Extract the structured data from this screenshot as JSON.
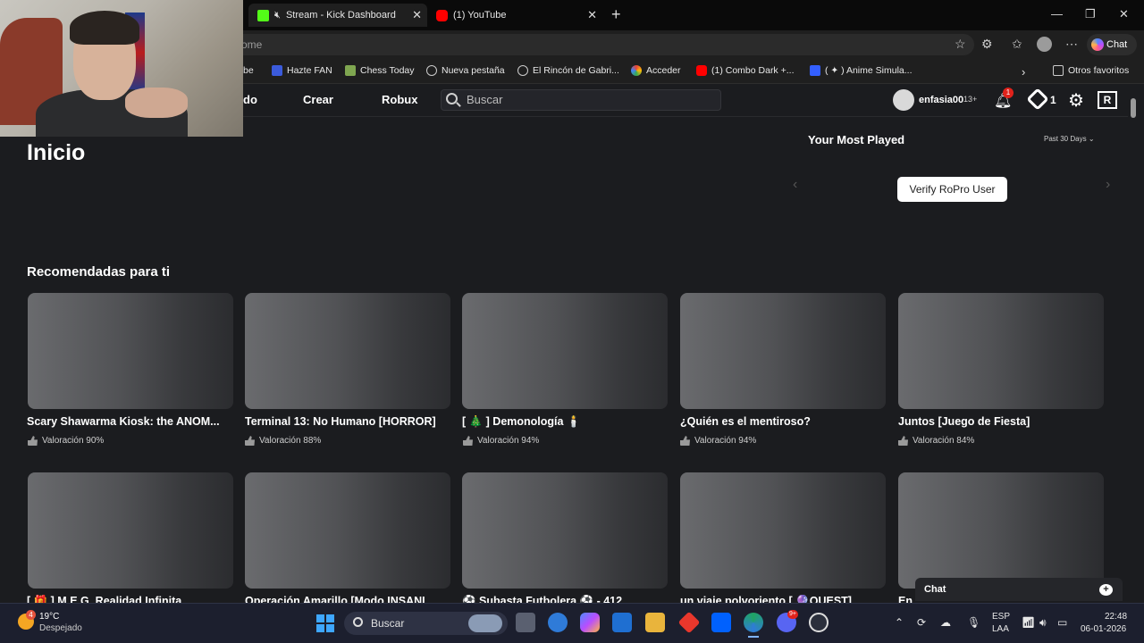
{
  "browser": {
    "tabs": [
      {
        "label": "Stream - Kick Dashboard"
      },
      {
        "label": "(1) YouTube"
      }
    ],
    "address_partial": "ome",
    "chat_label": "Chat",
    "bookmarks": [
      {
        "label": "be"
      },
      {
        "label": "Hazte FAN"
      },
      {
        "label": "Chess Today"
      },
      {
        "label": "Nueva pestaña"
      },
      {
        "label": "El Rincón de Gabri..."
      },
      {
        "label": "Acceder"
      },
      {
        "label": "(1) Combo Dark +..."
      },
      {
        "label": "( ✦ ) Anime Simula..."
      },
      {
        "label": "Otros favoritos"
      }
    ]
  },
  "nav": {
    "partial_link": "do",
    "create": "Crear",
    "robux": "Robux",
    "search_placeholder": "Buscar",
    "username": "enfasia00",
    "age_badge": "13+",
    "notification_count": "1",
    "robux_count": "1"
  },
  "main": {
    "title": "Inicio",
    "most_played": {
      "title": "Your Most Played",
      "range": "Past 30 Days",
      "verify_button": "Verify RoPro User"
    },
    "recommended_title": "Recomendadas para ti",
    "games_row1": [
      {
        "title": "Scary Shawarma Kiosk: the ANOM...",
        "rating": "Valoración 90%"
      },
      {
        "title": "Terminal 13: No Humano [HORROR]",
        "rating": "Valoración 88%"
      },
      {
        "title": "[ 🎄 ] Demonología 🕯️",
        "rating": "Valoración 94%"
      },
      {
        "title": "¿Quién es el mentiroso?",
        "rating": "Valoración 94%"
      },
      {
        "title": "Juntos [Juego de Fiesta]",
        "rating": "Valoración 84%"
      }
    ],
    "games_row2": [
      {
        "title": "[ 🎁 ] M.E.G. Realidad Infinita"
      },
      {
        "title": "Operación Amarillo [Modo INSANI"
      },
      {
        "title": "⚽ Subasta Futbolera ⚽ - 412"
      },
      {
        "title": "un viaje polvoriento [ 🔮QUEST]"
      },
      {
        "title": "En"
      }
    ],
    "chat_widget": "Chat"
  },
  "taskbar": {
    "weather_temp": "19°C",
    "weather_desc": "Despejado",
    "weather_badge": "4",
    "search_label": "Buscar",
    "lang_top": "ESP",
    "lang_bottom": "LAA",
    "time": "22:48",
    "date": "06-01-2026",
    "discord_badge": "9+"
  }
}
